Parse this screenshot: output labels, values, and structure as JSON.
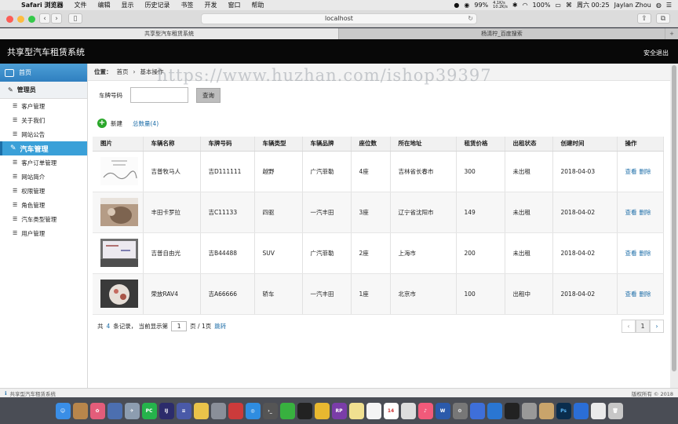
{
  "menubar": {
    "apple_glyph": "",
    "app": "Safari 浏览器",
    "items": [
      "文件",
      "编辑",
      "显示",
      "历史记录",
      "书签",
      "开发",
      "窗口",
      "帮助"
    ],
    "net_up": "4.1K/s",
    "net_down": "10.2K/s",
    "battery": "100%",
    "pct": "99%",
    "datetime": "周六 00:25",
    "user": "Jaylan Zhou"
  },
  "browser": {
    "url": "localhost",
    "tabs": [
      "共享型汽车租赁系统",
      "杨清柠_百度搜索"
    ]
  },
  "app": {
    "title": "共享型汽车租赁系统",
    "logout": "安全退出"
  },
  "sidebar": {
    "home": "首页",
    "admin": "管理员",
    "group1": [
      "客户管理",
      "关于我们",
      "网站公告"
    ],
    "section": "汽车管理",
    "group2": [
      "客户订单管理",
      "网站简介",
      "权限管理",
      "角色管理",
      "汽车类型管理",
      "用户管理"
    ]
  },
  "breadcrumb": {
    "label": "位置：",
    "home": "首页",
    "sep": "›",
    "current": "基本操作"
  },
  "watermark": "https://www.huzhan.com/ishop39397",
  "search": {
    "label": "车牌号码",
    "value": "",
    "button": "查询"
  },
  "actions": {
    "new": "新建",
    "total": "总数量(4)"
  },
  "table": {
    "headers": [
      "图片",
      "车辆名称",
      "车牌号码",
      "车辆类型",
      "车辆品牌",
      "座位数",
      "所在地址",
      "租赁价格",
      "出租状态",
      "创建时间",
      "操作"
    ],
    "rows": [
      {
        "name": "吉普牧马人",
        "plate": "吉D111111",
        "type": "越野",
        "brand": "广汽菲勒",
        "seats": "4座",
        "address": "吉林省长春市",
        "price": "300",
        "status": "未出租",
        "date": "2018-04-03"
      },
      {
        "name": "丰田卡罗拉",
        "plate": "吉C11133",
        "type": "四驱",
        "brand": "一汽丰田",
        "seats": "3座",
        "address": "辽宁省沈阳市",
        "price": "149",
        "status": "未出租",
        "date": "2018-04-02"
      },
      {
        "name": "吉普自由光",
        "plate": "吉B44488",
        "type": "SUV",
        "brand": "广汽菲勒",
        "seats": "2座",
        "address": "上海市",
        "price": "200",
        "status": "未出租",
        "date": "2018-04-02"
      },
      {
        "name": "荣放RAV4",
        "plate": "吉A66666",
        "type": "轿车",
        "brand": "一汽丰田",
        "seats": "1座",
        "address": "北京市",
        "price": "100",
        "status": "出租中",
        "date": "2018-04-02"
      }
    ],
    "op_view": "查看",
    "op_delete": "删除"
  },
  "pagination": {
    "prefix": "共",
    "count": "4",
    "mid": "条记录，  当前显示第",
    "page": "1",
    "suffix": "页 / 1页",
    "jump": "跳转",
    "prev": "‹",
    "current": "1",
    "next": "›"
  },
  "footer": {
    "info_icon": "ℹ",
    "left": "共享型汽车租赁系统",
    "right": "版权所有 © 2018"
  },
  "colors": {
    "header_bg": "#080808",
    "sidebar_active": "#3aa0d8",
    "link": "#1e6ea8",
    "plus_green": "#2aa72a"
  }
}
